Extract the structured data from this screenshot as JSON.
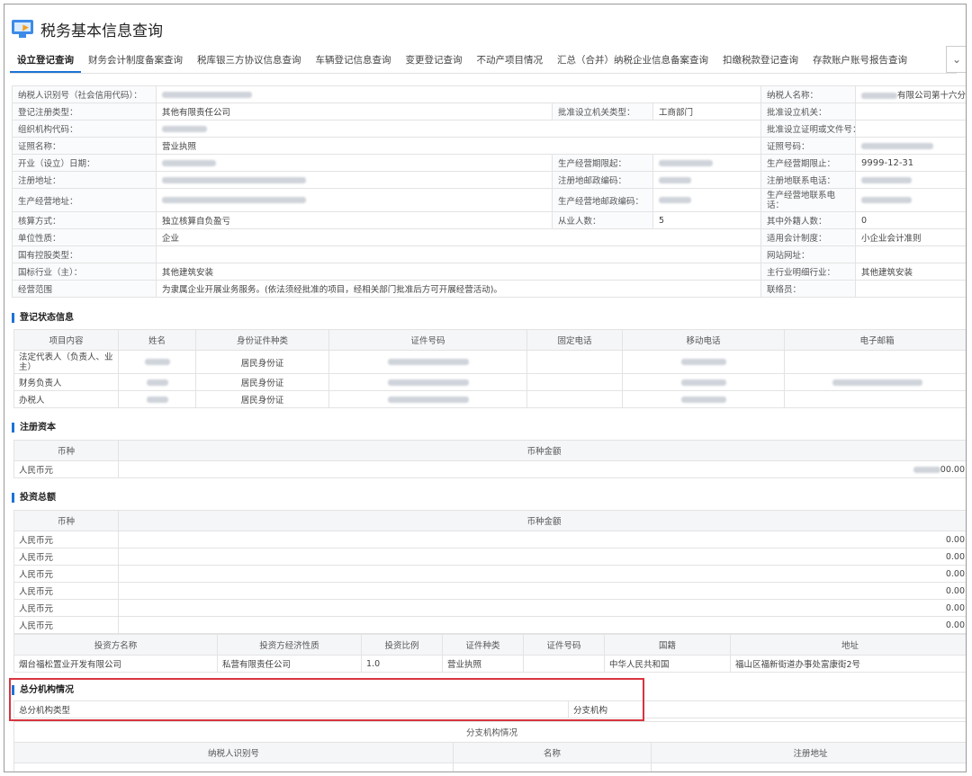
{
  "header": {
    "title": "税务基本信息查询"
  },
  "tabs": [
    "设立登记查询",
    "财务会计制度备案查询",
    "税库银三方协议信息查询",
    "车辆登记信息查询",
    "变更登记查询",
    "不动产项目情况",
    "汇总（合并）纳税企业信息备案查询",
    "扣缴税款登记查询",
    "存款账户账号报告查询"
  ],
  "info": {
    "rows": [
      [
        {
          "l": "纳税人识别号（社会信用代码）："
        },
        {
          "v": ""
        },
        {
          "l": "纳税人名称："
        },
        {
          "v": "有限公司第十六分公司"
        }
      ],
      [
        {
          "l": "登记注册类型："
        },
        {
          "v": "其他有限责任公司"
        },
        {
          "l": "批准设立机关类型："
        },
        {
          "v": "工商部门"
        },
        {
          "l": "批准设立机关："
        },
        {
          "v": ""
        }
      ],
      [
        {
          "l": "组织机构代码："
        },
        {
          "v": ""
        },
        {
          "l": "批准设立证明或文件号："
        },
        {
          "v": ""
        }
      ],
      [
        {
          "l": "证照名称："
        },
        {
          "v": "营业执照"
        },
        {
          "l": "证照号码："
        },
        {
          "v": ""
        }
      ],
      [
        {
          "l": "开业（设立）日期："
        },
        {
          "v": ""
        },
        {
          "l": "生产经营期限起："
        },
        {
          "v": ""
        },
        {
          "l": "生产经营期限止："
        },
        {
          "v": "9999-12-31"
        }
      ],
      [
        {
          "l": "注册地址："
        },
        {
          "v": ""
        },
        {
          "l": "注册地邮政编码："
        },
        {
          "v": ""
        },
        {
          "l": "注册地联系电话："
        },
        {
          "v": ""
        }
      ],
      [
        {
          "l": "生产经营地址："
        },
        {
          "v": ""
        },
        {
          "l": "生产经营地邮政编码："
        },
        {
          "v": ""
        },
        {
          "l": "生产经营地联系电话："
        },
        {
          "v": ""
        }
      ],
      [
        {
          "l": "核算方式："
        },
        {
          "v": "独立核算自负盈亏"
        },
        {
          "l": "从业人数："
        },
        {
          "v": "5"
        },
        {
          "l": "其中外籍人数："
        },
        {
          "v": "0"
        }
      ],
      [
        {
          "l": "单位性质："
        },
        {
          "v": "企业"
        },
        {
          "l": "适用会计制度："
        },
        {
          "v": "小企业会计准则"
        }
      ],
      [
        {
          "l": "国有控股类型："
        },
        {
          "v": ""
        },
        {
          "l": "网站网址："
        },
        {
          "v": ""
        }
      ],
      [
        {
          "l": "国标行业（主）："
        },
        {
          "v": "其他建筑安装"
        },
        {
          "l": "主行业明细行业："
        },
        {
          "v": "其他建筑安装"
        }
      ],
      [
        {
          "l": "经营范围"
        },
        {
          "v": "为隶属企业开展业务服务。(依法须经批准的项目，经相关部门批准后方可开展经营活动)。"
        },
        {
          "l": "联络员："
        },
        {
          "v": ""
        }
      ]
    ]
  },
  "registration_status": {
    "title": "登记状态信息",
    "columns": [
      "项目内容",
      "姓名",
      "身份证件种类",
      "证件号码",
      "固定电话",
      "移动电话",
      "电子邮箱"
    ],
    "rows": [
      [
        "法定代表人（负责人、业主）",
        "",
        "居民身份证",
        "",
        "",
        "",
        ""
      ],
      [
        "财务负责人",
        "",
        "居民身份证",
        "",
        "",
        "",
        ""
      ],
      [
        "办税人",
        "",
        "居民身份证",
        "",
        "",
        "",
        ""
      ]
    ]
  },
  "registered_capital": {
    "title": "注册资本",
    "columns": [
      "币种",
      "币种金额"
    ],
    "rows": [
      [
        "人民币元",
        "00.00"
      ]
    ]
  },
  "investment": {
    "title": "投资总额",
    "columns": [
      "币种",
      "币种金额"
    ],
    "rows": [
      [
        "人民币元",
        "0.00"
      ],
      [
        "人民币元",
        "0.00"
      ],
      [
        "人民币元",
        "0.00"
      ],
      [
        "人民币元",
        "0.00"
      ],
      [
        "人民币元",
        "0.00"
      ],
      [
        "人民币元",
        "0.00"
      ]
    ],
    "investor_columns": [
      "投资方名称",
      "投资方经济性质",
      "投资比例",
      "证件种类",
      "证件号码",
      "国籍",
      "地址"
    ],
    "investor_rows": [
      [
        "烟台福松置业开发有限公司",
        "私营有限责任公司",
        "1.0",
        "营业执照",
        "",
        "中华人民共和国",
        "福山区福新街道办事处富康街2号"
      ]
    ]
  },
  "branch": {
    "title": "总分机构情况",
    "type_label": "总分机构类型",
    "branch_label": "分支机构",
    "sub_title": "分支机构情况",
    "columns": [
      "纳税人识别号",
      "名称",
      "注册地址"
    ]
  }
}
